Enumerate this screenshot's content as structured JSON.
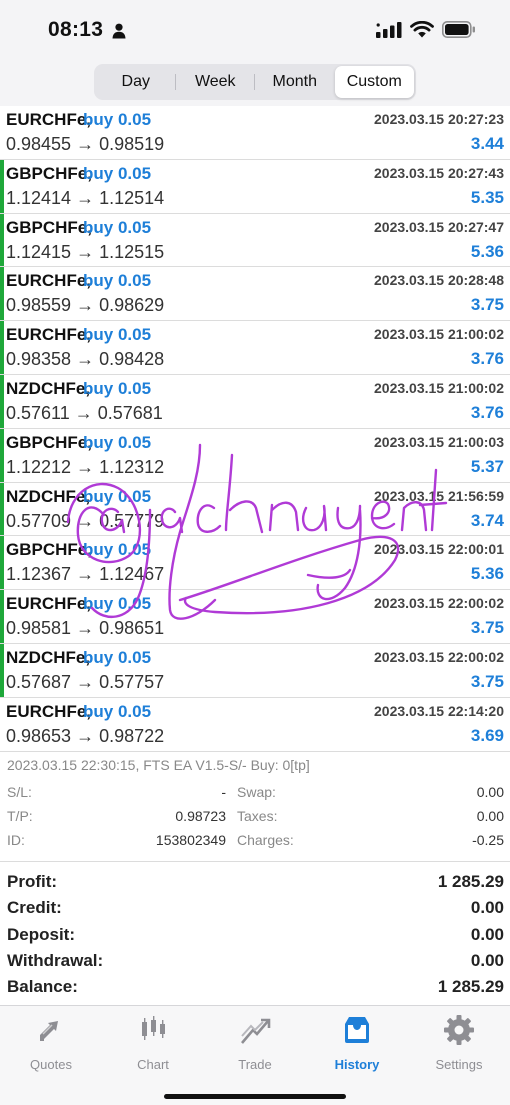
{
  "status_bar": {
    "time": "08:13"
  },
  "periods": [
    "Day",
    "Week",
    "Month",
    "Custom"
  ],
  "active_period": "Custom",
  "deals": [
    {
      "symbol": "EURCHFe,",
      "action": "buy 0.05",
      "timestamp": "2023.03.15 20:27:23",
      "prices": "0.98455 → 0.98519",
      "profit": "3.44",
      "marker": false
    },
    {
      "symbol": "GBPCHFe,",
      "action": "buy 0.05",
      "timestamp": "2023.03.15 20:27:43",
      "prices": "1.12414 → 1.12514",
      "profit": "5.35",
      "marker": true
    },
    {
      "symbol": "GBPCHFe,",
      "action": "buy 0.05",
      "timestamp": "2023.03.15 20:27:47",
      "prices": "1.12415 → 1.12515",
      "profit": "5.36",
      "marker": true
    },
    {
      "symbol": "EURCHFe,",
      "action": "buy 0.05",
      "timestamp": "2023.03.15 20:28:48",
      "prices": "0.98559 → 0.98629",
      "profit": "3.75",
      "marker": true
    },
    {
      "symbol": "EURCHFe,",
      "action": "buy 0.05",
      "timestamp": "2023.03.15 21:00:02",
      "prices": "0.98358 → 0.98428",
      "profit": "3.76",
      "marker": true
    },
    {
      "symbol": "NZDCHFe,",
      "action": "buy 0.05",
      "timestamp": "2023.03.15 21:00:02",
      "prices": "0.57611 → 0.57681",
      "profit": "3.76",
      "marker": true
    },
    {
      "symbol": "GBPCHFe,",
      "action": "buy 0.05",
      "timestamp": "2023.03.15 21:00:03",
      "prices": "1.12212 → 1.12312",
      "profit": "5.37",
      "marker": true
    },
    {
      "symbol": "NZDCHFe,",
      "action": "buy 0.05",
      "timestamp": "2023.03.15 21:56:59",
      "prices": "0.57709 → 0.57779",
      "profit": "3.74",
      "marker": true
    },
    {
      "symbol": "GBPCHFe,",
      "action": "buy 0.05",
      "timestamp": "2023.03.15 22:00:01",
      "prices": "1.12367 → 1.12467",
      "profit": "5.36",
      "marker": true
    },
    {
      "symbol": "EURCHFe,",
      "action": "buy 0.05",
      "timestamp": "2023.03.15 22:00:02",
      "prices": "0.98581 → 0.98651",
      "profit": "3.75",
      "marker": true
    },
    {
      "symbol": "NZDCHFe,",
      "action": "buy 0.05",
      "timestamp": "2023.03.15 22:00:02",
      "prices": "0.57687 → 0.57757",
      "profit": "3.75",
      "marker": true
    },
    {
      "symbol": "EURCHFe,",
      "action": "buy 0.05",
      "timestamp": "2023.03.15 22:14:20",
      "prices": "0.98653 → 0.98722",
      "profit": "3.69",
      "marker": false
    }
  ],
  "selected_deal": {
    "header": "2023.03.15 22:30:15, FTS EA V1.5-S/- Buy: 0[tp]",
    "sl_label": "S/L:",
    "sl_value": "-",
    "tp_label": "T/P:",
    "tp_value": "0.98723",
    "id_label": "ID:",
    "id_value": "153802349",
    "swap_label": "Swap:",
    "swap_value": "0.00",
    "taxes_label": "Taxes:",
    "taxes_value": "0.00",
    "charges_label": "Charges:",
    "charges_value": "-0.25"
  },
  "summary": [
    {
      "label": "Profit:",
      "value": "1 285.29"
    },
    {
      "label": "Credit:",
      "value": "0.00"
    },
    {
      "label": "Deposit:",
      "value": "0.00"
    },
    {
      "label": "Withdrawal:",
      "value": "0.00"
    },
    {
      "label": "Balance:",
      "value": "1 285.29"
    }
  ],
  "tabs": [
    {
      "label": "Quotes",
      "icon": "quotes-icon"
    },
    {
      "label": "Chart",
      "icon": "chart-icon"
    },
    {
      "label": "Trade",
      "icon": "trade-icon"
    },
    {
      "label": "History",
      "icon": "history-icon"
    },
    {
      "label": "Settings",
      "icon": "settings-icon"
    }
  ],
  "active_tab": "History",
  "signature_text": "@jacknguyen41",
  "colors": {
    "accent": "#1e7fd8",
    "buy_marker": "#1fa83a",
    "signature": "#b03ad6"
  }
}
